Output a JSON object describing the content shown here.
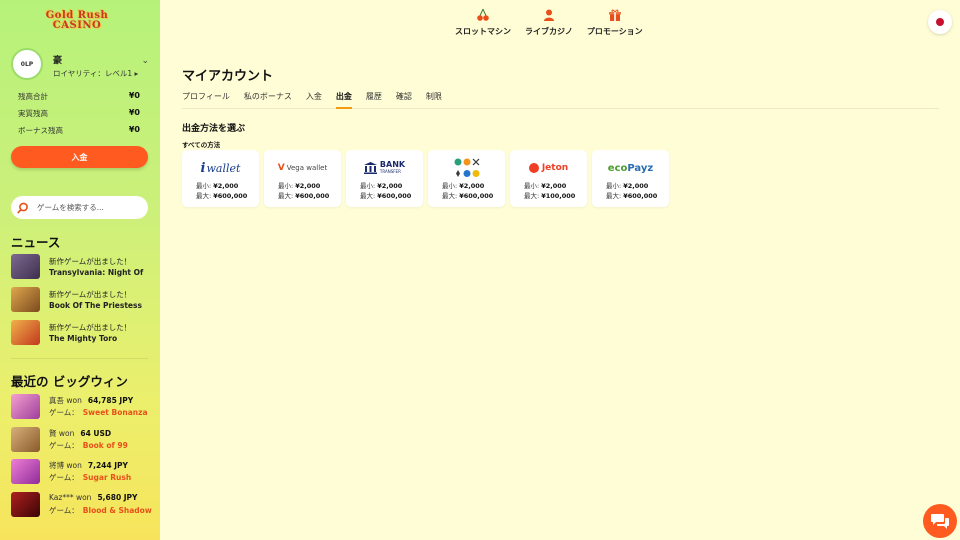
{
  "brand": {
    "logo_line1": "Gold Rush",
    "logo_line2": "CASINO"
  },
  "player": {
    "avatar_text": "0LP",
    "name": "豪",
    "loyalty": "ロイヤリティ：レベル1 ▸"
  },
  "balances": [
    {
      "label": "残高合計",
      "value": "¥0"
    },
    {
      "label": "実質残高",
      "value": "¥0"
    },
    {
      "label": "ボーナス残高",
      "value": "¥0"
    }
  ],
  "deposit_button": "入金",
  "search": {
    "placeholder": "ゲームを検索する..."
  },
  "news": {
    "title": "ニュース",
    "items": [
      {
        "line1": "新作ゲームが出ました！",
        "line2": "Transylvania: Night Of",
        "color": "#5b4a6b"
      },
      {
        "line1": "新作ゲームが出ました！",
        "line2": "Book Of The Priestess",
        "color": "#c8873a"
      },
      {
        "line1": "新作ゲームが出ました！",
        "line2": "The Mighty Toro",
        "color": "#d9532b"
      }
    ]
  },
  "big_wins": {
    "title": "最近の ビッグウィン",
    "game_prefix": "ゲーム：",
    "items": [
      {
        "user": "真吾 won",
        "amount": "64,785 JPY",
        "game": "Sweet Bonanza",
        "color": "#e86fa8"
      },
      {
        "user": "賢 won",
        "amount": "64 USD",
        "game": "Book of 99",
        "color": "#b08556"
      },
      {
        "user": "将博 won",
        "amount": "7,244 JPY",
        "game": "Sugar Rush",
        "color": "#d14fb4"
      },
      {
        "user": "Kaz*** won",
        "amount": "5,680 JPY",
        "game": "Blood & Shadow",
        "color": "#7a1010"
      }
    ]
  },
  "topnav": [
    {
      "label": "スロットマシン",
      "icon": "cherry-icon"
    },
    {
      "label": "ライブカジノ",
      "icon": "dealer-icon"
    },
    {
      "label": "プロモーション",
      "icon": "gift-icon"
    }
  ],
  "page_title": "マイアカウント",
  "tabs": [
    "プロフィール",
    "私のボーナス",
    "入金",
    "出金",
    "履歴",
    "確認",
    "制限"
  ],
  "active_tab": "出金",
  "withdraw": {
    "heading": "出金方法を選ぶ",
    "all_methods": "すべての方法",
    "min_label": "最小:",
    "max_label": "最大:",
    "methods": [
      {
        "name": "iwallet",
        "logo_text": "wallet",
        "min": "¥2,000",
        "max": "¥600,000"
      },
      {
        "name": "vega-wallet",
        "logo_text": "Vega wallet",
        "min": "¥2,000",
        "max": "¥600,000"
      },
      {
        "name": "bank-transfer",
        "logo_text": "BANK",
        "logo_sub": "TRANSFER",
        "min": "¥2,000",
        "max": "¥600,000"
      },
      {
        "name": "crypto",
        "logo_text": "",
        "min": "¥2,000",
        "max": "¥600,000"
      },
      {
        "name": "jeton",
        "logo_text": "Jeton",
        "min": "¥2,000",
        "max": "¥100,000"
      },
      {
        "name": "ecopayz",
        "logo_text": "eco",
        "logo_text2": "Payz",
        "min": "¥2,000",
        "max": "¥600,000"
      }
    ]
  },
  "colors": {
    "accent": "#ff5a1f",
    "tab_underline": "#f39c12",
    "background": "#fffdd6"
  }
}
